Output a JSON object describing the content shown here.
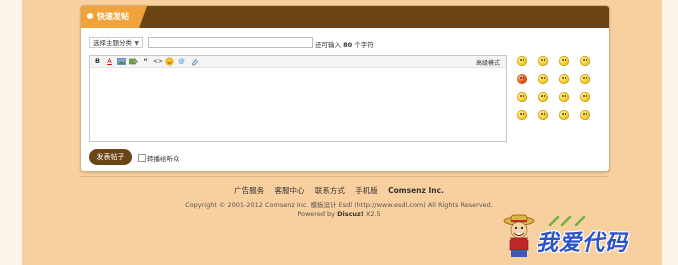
{
  "panel": {
    "title": "快速发帖",
    "subject_select": "选择主题分类",
    "char_hint_prefix": "还可输入",
    "char_hint_count": "80",
    "char_hint_suffix": "个字符",
    "advanced_mode": "高级模式",
    "submit_label": "发表帖子",
    "sync_label": "转播给听众"
  },
  "toolbar": {
    "items": [
      "bold-icon",
      "font-color-icon",
      "image-icon",
      "link-icon",
      "quote-icon",
      "code-icon",
      "smiley-icon",
      "at-icon",
      "attachment-icon"
    ],
    "bold_glyph": "B",
    "fontcolor_glyph": "A",
    "quote_glyph": "“",
    "code_glyph": "<>",
    "at_glyph": "@"
  },
  "smileys": {
    "count": 16,
    "columns": 4,
    "rows": 4
  },
  "footer": {
    "links": [
      "广告服务",
      "客服中心",
      "联系方式",
      "手机版"
    ],
    "company": "Comsenz Inc.",
    "copyright": "Copyright © 2001-2012 Comsenz Inc. 模板设计 Esdl (http://www.esdl.com) All Rights Reserved.",
    "powered_prefix": "Powered by",
    "powered_product": "Discuz!",
    "powered_version": "X2.5"
  },
  "brand": {
    "logo_text": "我爱代码"
  },
  "colors": {
    "header_brown": "#6b4516",
    "header_orange": "#f0a33a",
    "page_bg": "#f8cf9f"
  }
}
